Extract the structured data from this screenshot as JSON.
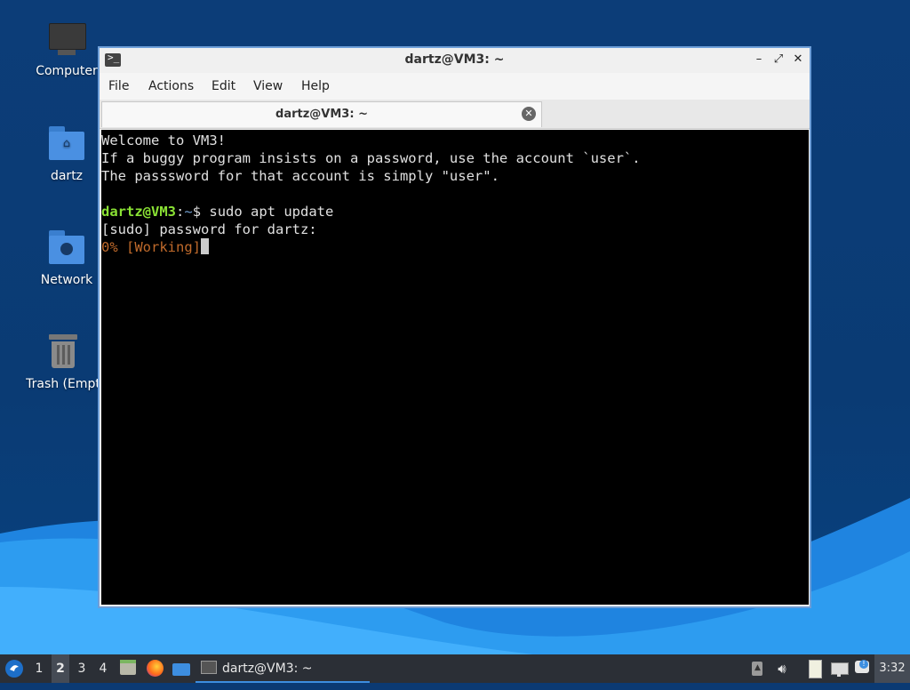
{
  "desktop": {
    "icons": [
      {
        "label": "Computer",
        "icon": "computer-icon"
      },
      {
        "label": "dartz",
        "icon": "home-folder-icon"
      },
      {
        "label": "Network",
        "icon": "network-folder-icon"
      },
      {
        "label": "Trash (Empt",
        "icon": "trash-icon"
      }
    ]
  },
  "window": {
    "title": "dartz@VM3: ~",
    "icon": "terminal-icon",
    "controls": {
      "minimize": "–",
      "maximize": "⤢",
      "close": "✕"
    }
  },
  "menu": {
    "items": [
      "File",
      "Actions",
      "Edit",
      "View",
      "Help"
    ]
  },
  "tab": {
    "label": "dartz@VM3: ~",
    "close": "✕"
  },
  "terminal": {
    "welcome": "Welcome to VM3!",
    "line2": "If a buggy program insists on a password, use the account `user`.",
    "line3": "The passsword for that account is simply \"user\".",
    "prompt_user": "dartz@VM3",
    "prompt_sep": ":",
    "prompt_path": "~",
    "prompt_dollar": "$ ",
    "command": "sudo apt update",
    "sudo_prompt": "[sudo] password for dartz:",
    "progress": "0% [Working]"
  },
  "taskbar": {
    "workspaces": [
      "1",
      "2",
      "3",
      "4"
    ],
    "active_workspace": "2",
    "launchers": [
      "file-manager-icon",
      "firefox-icon",
      "show-desktop-icon"
    ],
    "task_label": "dartz@VM3: ~",
    "tray": [
      "update-icon",
      "volume-icon",
      "clipboard-icon",
      "network-icon",
      "notification-icon"
    ],
    "clock": "3:32"
  },
  "colors": {
    "prompt_user": "#8ae234",
    "prompt_path": "#729fcf",
    "working": "#c06a2b",
    "window_border": "#6d9ed8",
    "taskbar": "#2b2f36"
  }
}
